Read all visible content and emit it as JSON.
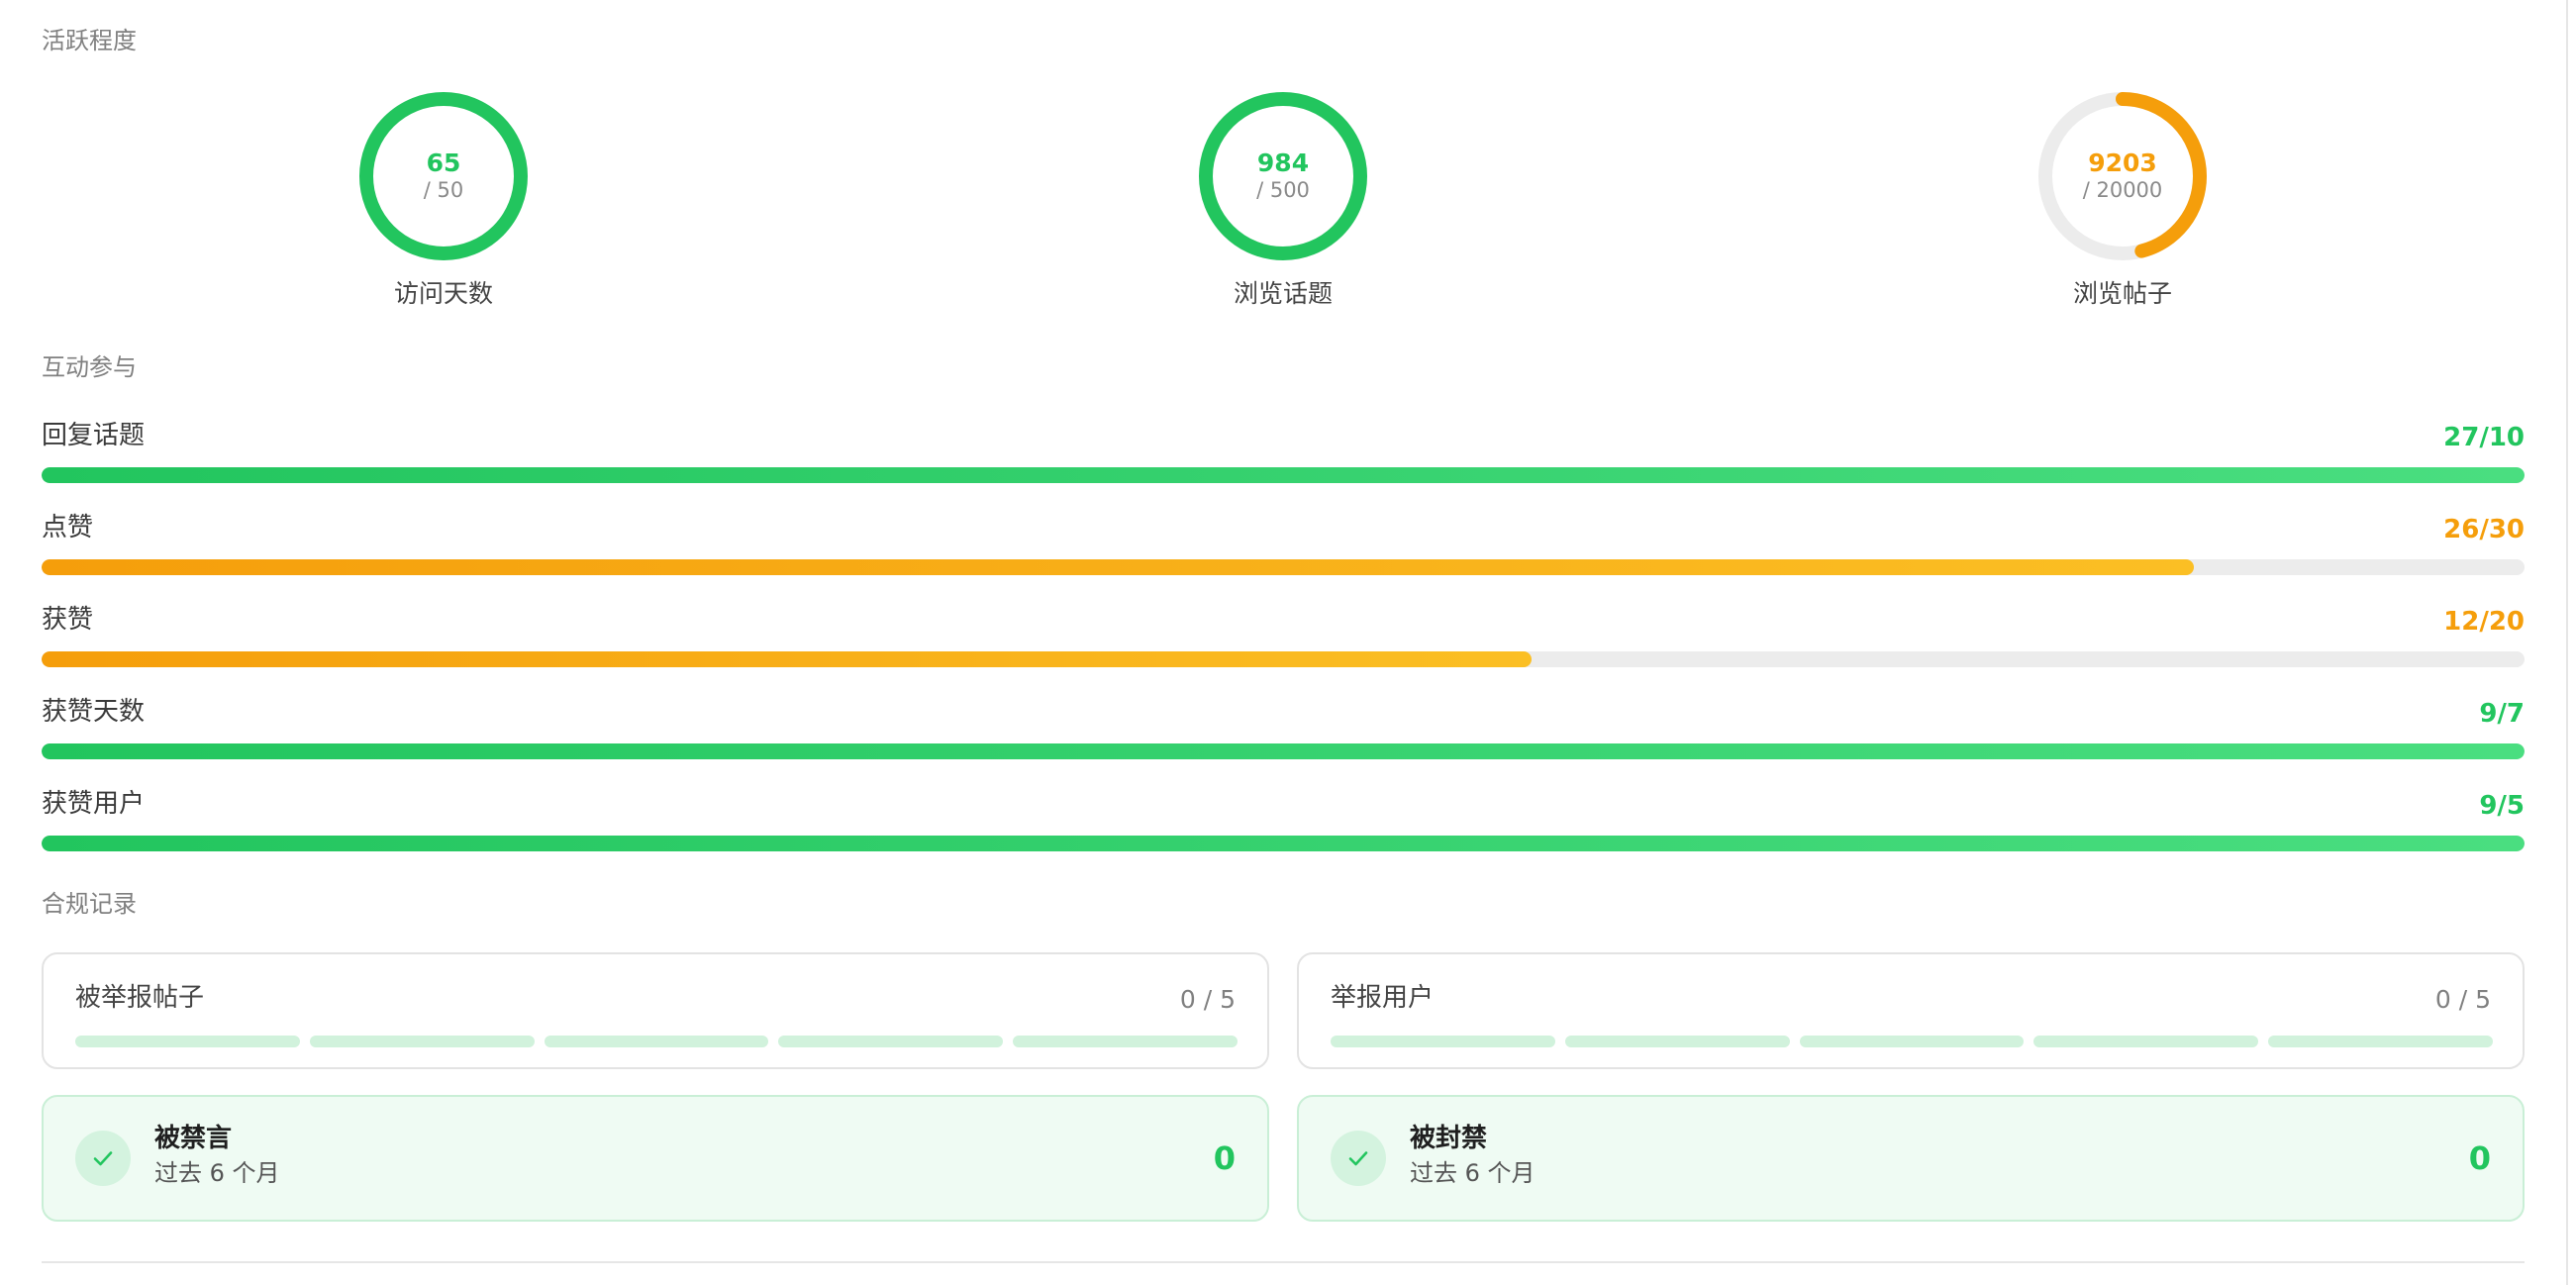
{
  "sections": {
    "activity": "活跃程度",
    "interaction": "互动参与",
    "compliance": "合规记录"
  },
  "rings": [
    {
      "value": "65",
      "max": "/ 50",
      "label": "访问天数",
      "progress": 1.0,
      "color": "#22c55e"
    },
    {
      "value": "984",
      "max": "/ 500",
      "label": "浏览话题",
      "progress": 1.0,
      "color": "#22c55e"
    },
    {
      "value": "9203",
      "max": "/ 20000",
      "label": "浏览帖子",
      "progress": 0.46,
      "color": "#f59e0b"
    }
  ],
  "progress_rows": [
    {
      "label": "回复话题",
      "value": "27/10",
      "progress": 1.0,
      "status": "green"
    },
    {
      "label": "点赞",
      "value": "26/30",
      "progress": 0.867,
      "status": "orange"
    },
    {
      "label": "获赞",
      "value": "12/20",
      "progress": 0.6,
      "status": "orange"
    },
    {
      "label": "获赞天数",
      "value": "9/7",
      "progress": 1.0,
      "status": "green"
    },
    {
      "label": "获赞用户",
      "value": "9/5",
      "progress": 1.0,
      "status": "green"
    }
  ],
  "colors": {
    "green": "#22c55e",
    "orange": "#f59e0b",
    "track": "#ececec",
    "segment": "#d1f2dc"
  },
  "reports": [
    {
      "label": "被举报帖子",
      "value": "0 / 5",
      "segments": 5
    },
    {
      "label": "举报用户",
      "value": "0 / 5",
      "segments": 5
    }
  ],
  "penalties": [
    {
      "title": "被禁言",
      "subtitle": "过去 6 个月",
      "count": "0",
      "icon": "check-icon"
    },
    {
      "title": "被封禁",
      "subtitle": "过去 6 个月",
      "count": "0",
      "icon": "check-icon"
    }
  ]
}
